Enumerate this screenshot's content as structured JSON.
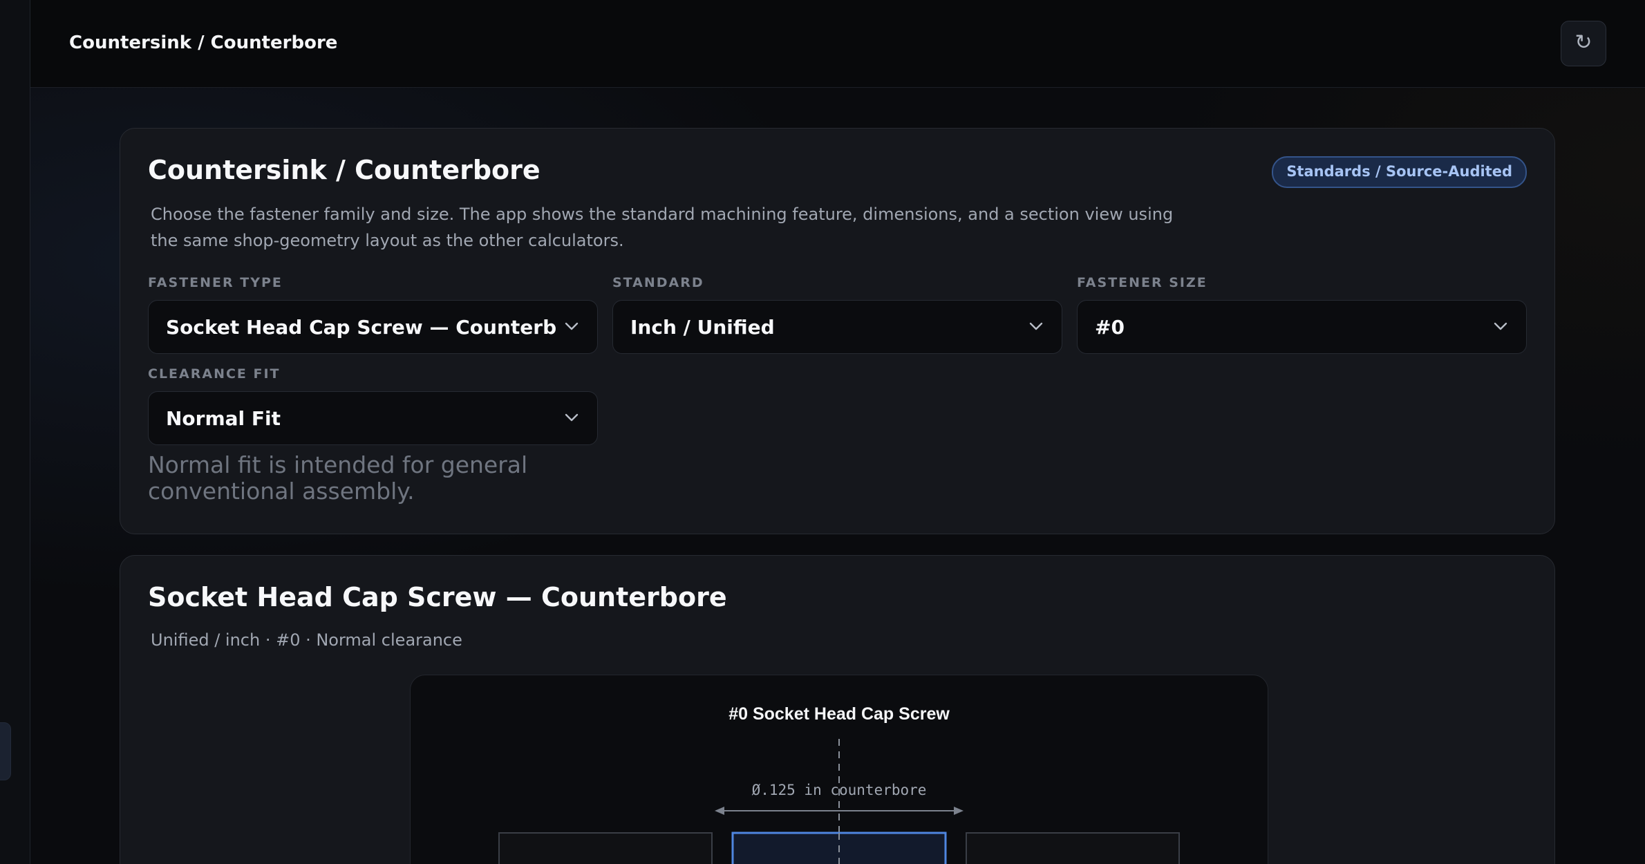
{
  "topbar": {
    "title": "Countersink / Counterbore",
    "refresh_icon": "↻"
  },
  "inputs_card": {
    "title": "Countersink / Counterbore",
    "badge": "Standards / Source-Audited",
    "description": "Choose the fastener family and size. The app shows the standard machining feature, dimensions, and a section view using the same shop-geometry layout as the other calculators.",
    "fastener_type": {
      "label": "FASTENER TYPE",
      "value": "Socket Head Cap Screw — Counterbore"
    },
    "standard": {
      "label": "STANDARD",
      "value": "Inch / Unified"
    },
    "fastener_size": {
      "label": "FASTENER SIZE",
      "value": "#0"
    },
    "clearance_fit": {
      "label": "CLEARANCE FIT",
      "value": "Normal Fit",
      "note": "Normal fit is intended for general conventional assembly."
    }
  },
  "result_card": {
    "title": "Socket Head Cap Screw — Counterbore",
    "subtitle": "Unified / inch · #0 · Normal clearance",
    "diagram": {
      "title": "#0 Socket Head Cap Screw",
      "dimension_label": "Ø.125 in counterbore"
    }
  },
  "colors": {
    "accent": "#4f86e0",
    "badge_bg": "#1a2a48",
    "badge_text": "#a7c4f4"
  }
}
